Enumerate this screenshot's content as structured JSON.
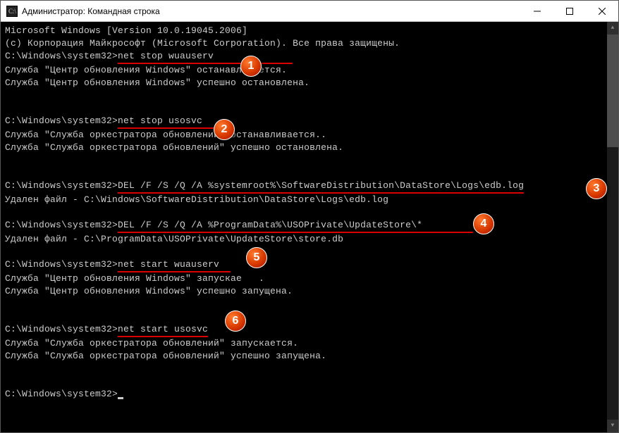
{
  "titlebar": {
    "title": "Администратор: Командная строка"
  },
  "terminal": {
    "l1": "Microsoft Windows [Version 10.0.19045.2006]",
    "l2": "(c) Корпорация Майкрософт (Microsoft Corporation). Все права защищены.",
    "blank": "",
    "prompt": "C:\\Windows\\system32>",
    "cmd1": "net stop wuauserv",
    "cmd1pad": "              ",
    "out1a": "Служба \"Центр обновления Windows\" останавливается.",
    "out1b": "Служба \"Центр обновления Windows\" успешно остановлена.",
    "cmd2": "net stop usosvc",
    "cmd2pad": "    ",
    "out2a": "Служба \"Служба оркестратора обновлений\" останавливается..",
    "out2b": "Служба \"Служба оркестратора обновлений\" успешно остановлена.",
    "cmd3": "DEL /F /S /Q /A %systemroot%\\SoftwareDistribution\\DataStore\\Logs\\edb.log",
    "out3": "Удален файл - C:\\Windows\\SoftwareDistribution\\DataStore\\Logs\\edb.log",
    "cmd4": "DEL /F /S /Q /A %ProgramData%\\USOPrivate\\UpdateStore\\*",
    "cmd4pad": "         ",
    "out4": "Удален файл - C:\\ProgramData\\USOPrivate\\UpdateStore\\store.db",
    "cmd5": "net start wuauserv",
    "cmd5pad": "  ",
    "out5a": "Служба \"Центр обновления Windows\" запускае   .",
    "out5b": "Служба \"Центр обновления Windows\" успешно запущена.",
    "cmd6": "net start usosvc",
    "out6a": "Служба \"Служба оркестратора обновлений\" запускается.",
    "out6b": "Служба \"Служба оркестратора обновлений\" успешно запущена."
  },
  "markers": {
    "m1": "1",
    "m2": "2",
    "m3": "3",
    "m4": "4",
    "m5": "5",
    "m6": "6"
  }
}
